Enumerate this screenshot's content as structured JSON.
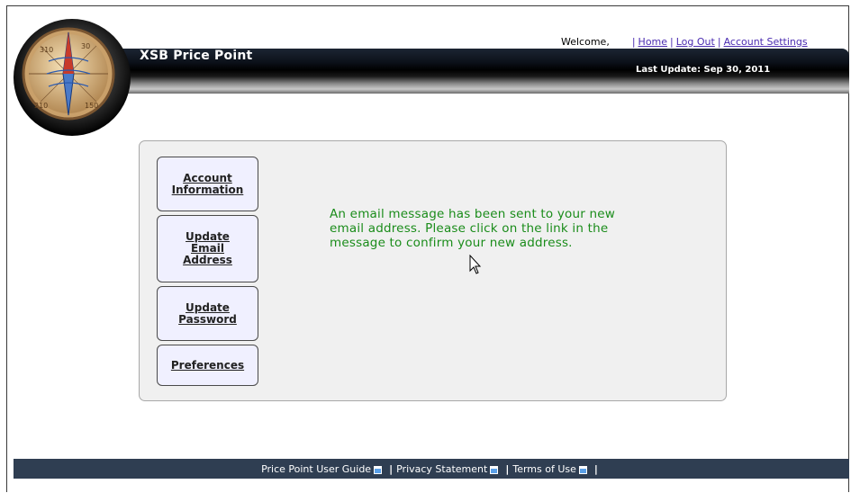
{
  "app": {
    "title": "XSB Price Point",
    "last_update": "Last Update: Sep 30, 2011"
  },
  "top_nav": {
    "welcome": "Welcome,",
    "separator": "|",
    "home": "Home",
    "logout": "Log Out",
    "account_settings": "Account Settings"
  },
  "side_nav": {
    "items": [
      {
        "lines": [
          "Account",
          "Information"
        ]
      },
      {
        "lines": [
          "Update",
          "Email",
          "Address"
        ]
      },
      {
        "lines": [
          "Update",
          "Password"
        ]
      },
      {
        "lines": [
          "Preferences"
        ]
      }
    ]
  },
  "main": {
    "message_lines": [
      "An email message has been sent to your new",
      "email address. Please click on the link in the",
      "message to confirm your new address."
    ]
  },
  "footer": {
    "links": [
      "Price Point User Guide",
      "Privacy Statement",
      "Terms of Use"
    ],
    "separator": "|"
  },
  "colors": {
    "message_green": "#1a8c1a",
    "link_purple": "#4a2bb0",
    "footer_bg": "#2f3e52",
    "button_bg": "#f0f0ff"
  },
  "icons": {
    "logo": "compass-icon",
    "external": "external-link-icon",
    "pointer": "mouse-cursor-icon"
  }
}
